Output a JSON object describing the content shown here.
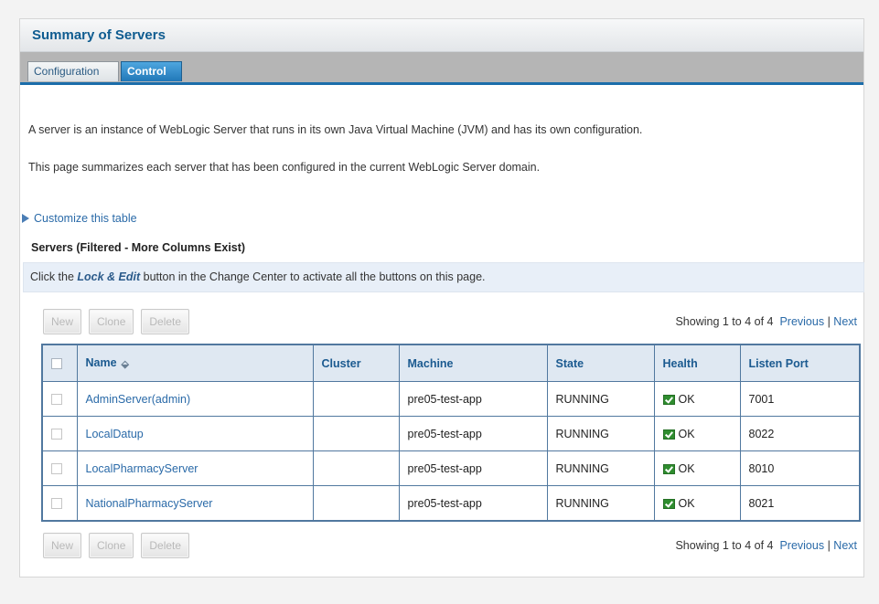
{
  "page": {
    "title": "Summary of Servers",
    "tabs": [
      "Configuration",
      "Control"
    ],
    "description_1": "A server is an instance of WebLogic Server that runs in its own Java Virtual Machine (JVM) and has its own configuration.",
    "description_2": "This page summarizes each server that has been configured in the current WebLogic Server domain.",
    "customize_link": "Customize this table"
  },
  "table": {
    "title": "Servers (Filtered - More Columns Exist)",
    "notice_prefix": "Click the ",
    "notice_action": "Lock & Edit",
    "notice_suffix": " button in the Change Center to activate all the buttons on this page.",
    "buttons": {
      "new": "New",
      "clone": "Clone",
      "delete": "Delete"
    },
    "pager": {
      "showing": "Showing 1 to 4 of 4",
      "previous": "Previous",
      "separator": "|",
      "next": "Next"
    },
    "columns": [
      "Name",
      "Cluster",
      "Machine",
      "State",
      "Health",
      "Listen Port"
    ],
    "rows": [
      {
        "name": "AdminServer(admin)",
        "cluster": "",
        "machine": "pre05-test-app",
        "state": "RUNNING",
        "health": "OK",
        "port": "7001"
      },
      {
        "name": "LocalDatup",
        "cluster": "",
        "machine": "pre05-test-app",
        "state": "RUNNING",
        "health": "OK",
        "port": "8022"
      },
      {
        "name": "LocalPharmacyServer",
        "cluster": "",
        "machine": "pre05-test-app",
        "state": "RUNNING",
        "health": "OK",
        "port": "8010"
      },
      {
        "name": "NationalPharmacyServer",
        "cluster": "",
        "machine": "pre05-test-app",
        "state": "RUNNING",
        "health": "OK",
        "port": "8021"
      }
    ]
  },
  "colors": {
    "accent": "#1b6daa",
    "link": "#2a6aa8",
    "header_bg": "#dfe8f2",
    "health_ok": "#2f8d2f"
  },
  "icons": {
    "sort": "sort-ascending-icon",
    "customize": "expand-triangle-icon",
    "health": "check-icon"
  }
}
